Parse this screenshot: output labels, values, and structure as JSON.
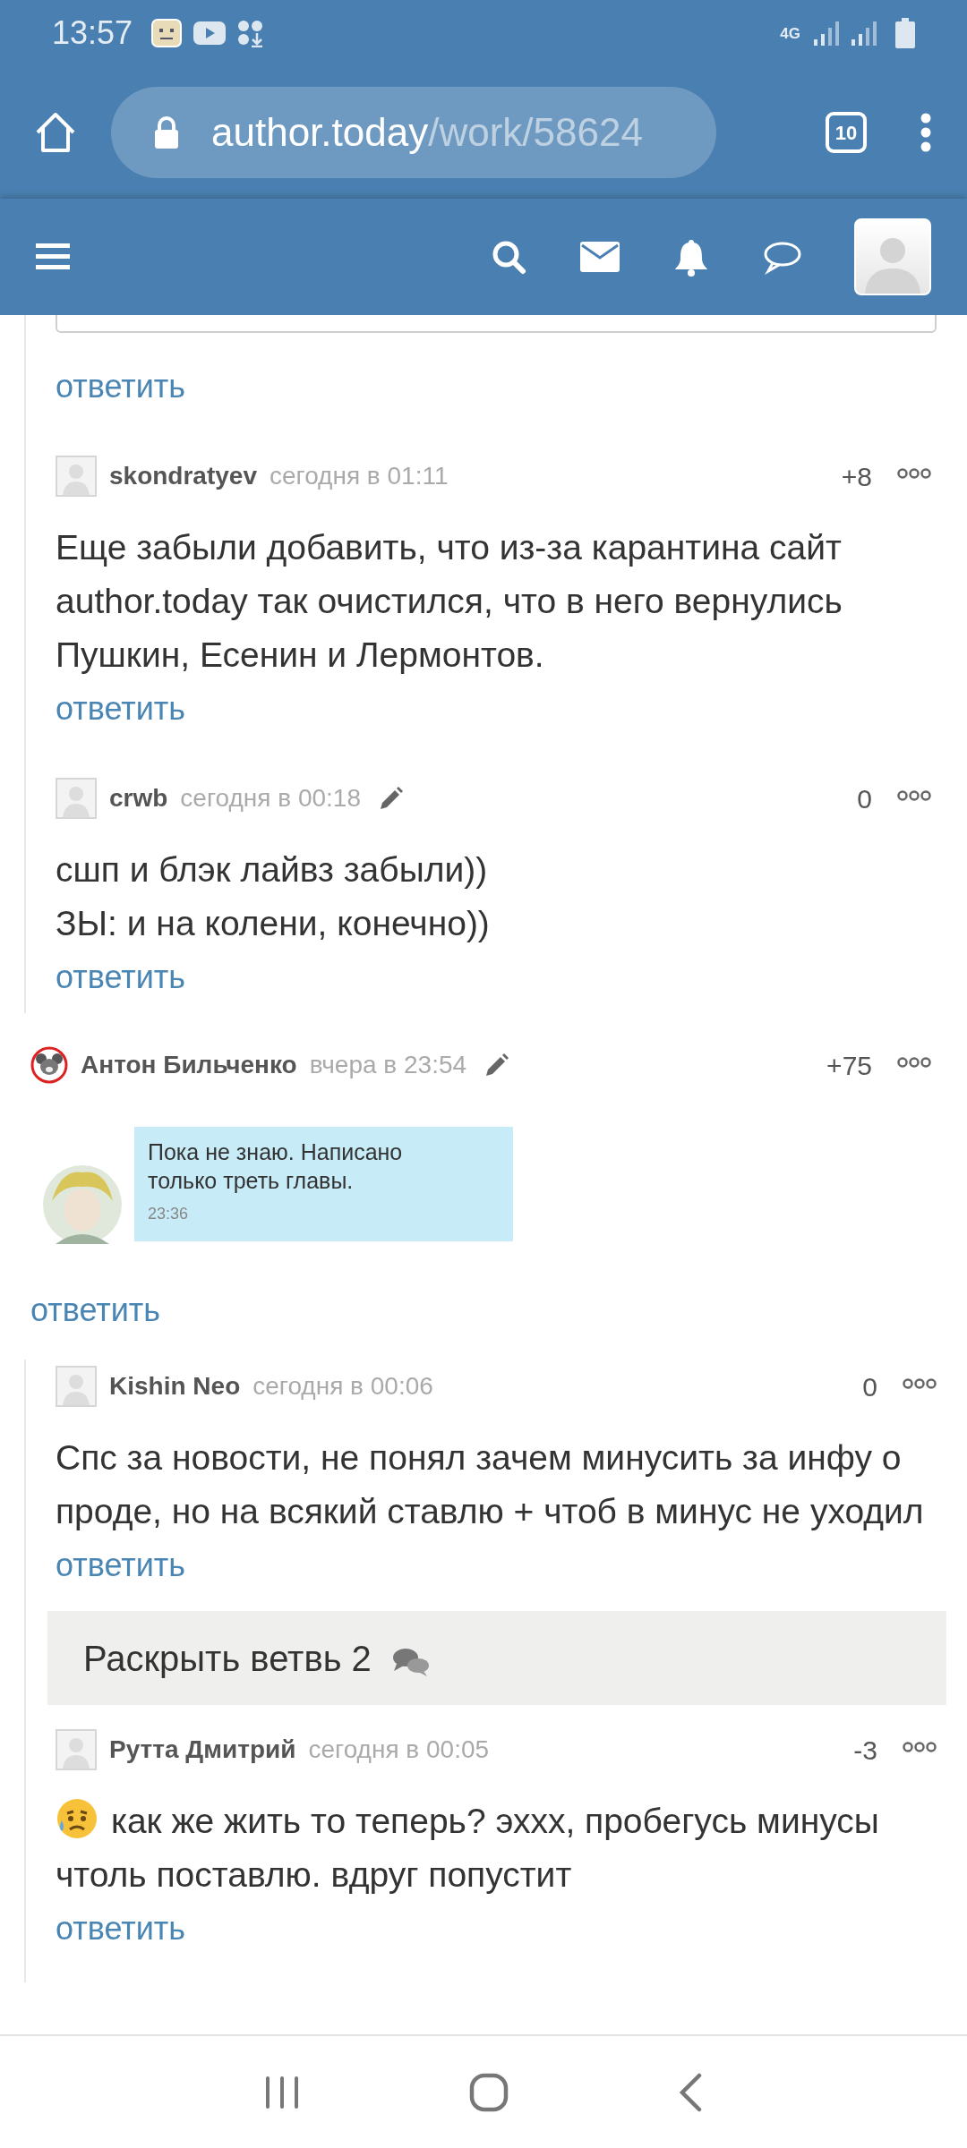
{
  "status_bar": {
    "time": "13:57",
    "network": "4G"
  },
  "browser": {
    "url_host": "author.today",
    "url_path": "/work/58624",
    "tab_count": "10"
  },
  "thread_top": {
    "reply_label": "ответить",
    "replies": [
      {
        "author": "skondratyev",
        "time": "сегодня в 01:11",
        "edited": false,
        "score": "+8",
        "round_avatar": false,
        "text": "Еще забыли добавить, что из-за карантина сайт author.today так очистился, что в него вернулись Пушкин, Есенин и Лермонтов.",
        "emoji": false,
        "reply_label": "ответить"
      },
      {
        "author": "crwb",
        "time": "сегодня в 00:18",
        "edited": true,
        "score": "0",
        "round_avatar": false,
        "text": "сшп и блэк лайвз забыли))\nЗЫ: и на колени, конечно))",
        "emoji": false,
        "reply_label": "ответить"
      }
    ]
  },
  "comment": {
    "author": "Антон Бильченко",
    "time": "вчера в 23:54",
    "edited": true,
    "score": "+75",
    "round_avatar": true,
    "chat": {
      "text": "Пока не знаю. Написано только треть главы.",
      "time": "23:36"
    },
    "reply_label": "ответить",
    "children": [
      {
        "kind": "comment",
        "author": "Kishin Neo",
        "time": "сегодня в 00:06",
        "edited": false,
        "score": "0",
        "round_avatar": false,
        "text": "Спс за новости, не понял зачем минусить за инфу о проде, но на всякий ставлю + чтоб в минус не уходил",
        "emoji": false,
        "reply_label": "ответить"
      },
      {
        "kind": "expand",
        "label": "Раскрыть ветвь 2"
      },
      {
        "kind": "comment",
        "author": "Рутта Дмитрий",
        "time": "сегодня в 00:05",
        "edited": false,
        "score": "-3",
        "round_avatar": false,
        "text": "как же жить то теперь? эххх, пробегусь минусы чтоль поставлю. вдруг попустит",
        "emoji": true,
        "reply_label": "ответить"
      }
    ]
  }
}
